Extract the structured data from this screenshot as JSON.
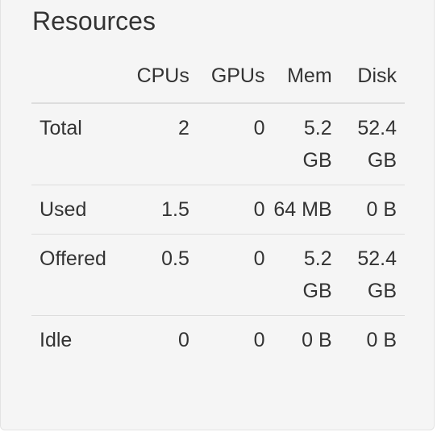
{
  "panel": {
    "title": "Resources"
  },
  "table": {
    "headers": [
      "",
      "CPUs",
      "GPUs",
      "Mem",
      "Disk"
    ],
    "rows": [
      {
        "label": "Total",
        "cpus": "2",
        "gpus": "0",
        "mem": "5.2 GB",
        "disk": "52.4 GB"
      },
      {
        "label": "Used",
        "cpus": "1.5",
        "gpus": "0",
        "mem": "64 MB",
        "disk": "0 B"
      },
      {
        "label": "Offered",
        "cpus": "0.5",
        "gpus": "0",
        "mem": "5.2 GB",
        "disk": "52.4 GB"
      },
      {
        "label": "Idle",
        "cpus": "0",
        "gpus": "0",
        "mem": "0 B",
        "disk": "0 B"
      }
    ]
  }
}
